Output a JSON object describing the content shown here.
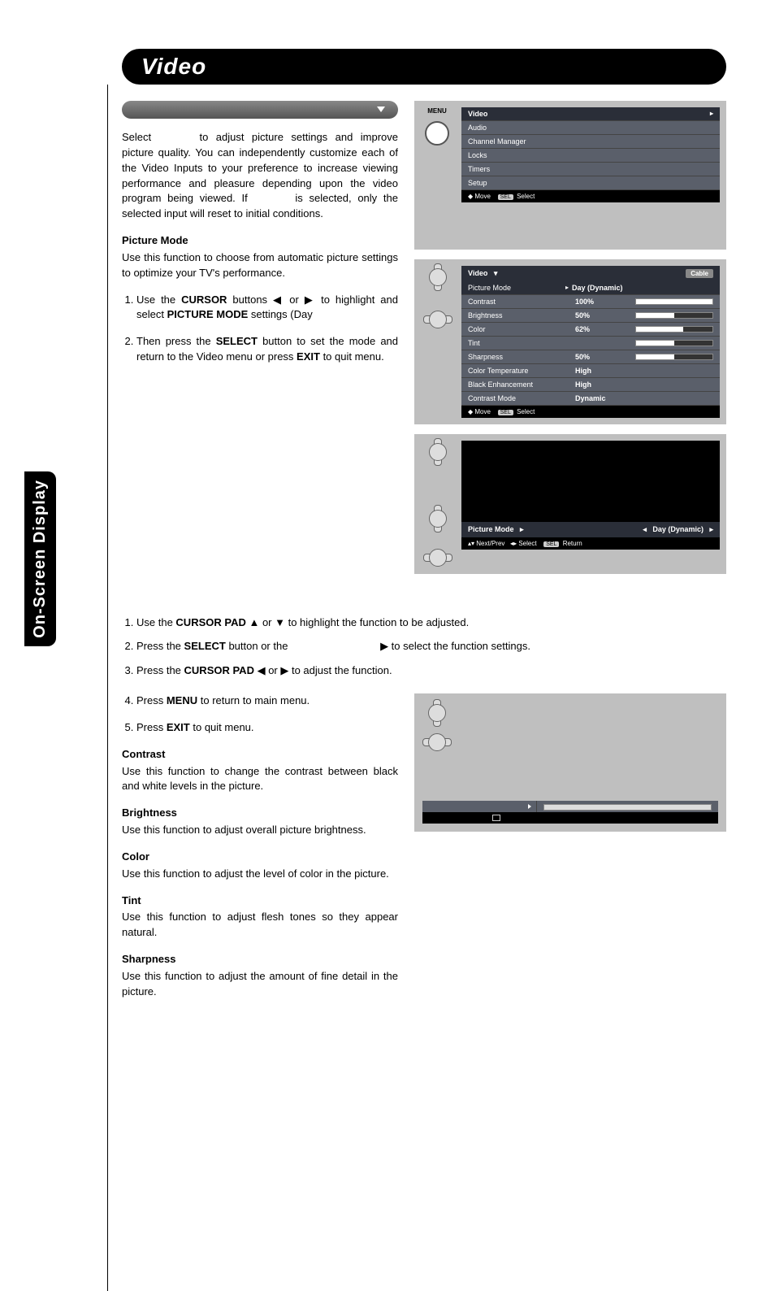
{
  "sideTab": "On-Screen Display",
  "header": "Video",
  "intro": {
    "p1a": "Select ",
    "p1b": " to adjust picture settings and improve picture quality. You can independently customize each of the Video Inputs to your preference to increase viewing performance and pleasure depending upon the video program being viewed. If ",
    "p1c": " is selected, only the selected input will reset to initial conditions."
  },
  "pictureMode": {
    "heading": "Picture Mode",
    "desc": "Use this function to choose from automatic picture settings to optimize your TV's performance.",
    "step1a": "Use the ",
    "step1b": "CURSOR",
    "step1c": " buttons ◀ or ▶ to highlight and select ",
    "step1d": "PICTURE MODE",
    "step1e": " settings (Day",
    "step2a": "Then press the ",
    "step2b": "SELECT",
    "step2c": " button to set the mode and return to the Video menu or press ",
    "step2d": "EXIT",
    "step2e": " to quit menu."
  },
  "osd1": {
    "menuLabel": "MENU",
    "items": [
      "Video",
      "Audio",
      "Channel Manager",
      "Locks",
      "Timers",
      "Setup"
    ],
    "hintMove": "Move",
    "hintSelect": "Select",
    "hintSel": "SEL"
  },
  "osd2": {
    "title": "Video",
    "source": "Cable",
    "rows": [
      {
        "label": "Picture Mode",
        "value": "Day (Dynamic)",
        "bar": null
      },
      {
        "label": "Contrast",
        "value": "100%",
        "bar": 100
      },
      {
        "label": "Brightness",
        "value": "50%",
        "bar": 50
      },
      {
        "label": "Color",
        "value": "62%",
        "bar": 62
      },
      {
        "label": "Tint",
        "value": "",
        "bar": 50
      },
      {
        "label": "Sharpness",
        "value": "50%",
        "bar": 50
      },
      {
        "label": "Color Temperature",
        "value": "High",
        "bar": null
      },
      {
        "label": "Black Enhancement",
        "value": "High",
        "bar": null
      },
      {
        "label": "Contrast Mode",
        "value": "Dynamic",
        "bar": null
      }
    ],
    "hintMove": "Move",
    "hintSel": "SEL",
    "hintSelect": "Select"
  },
  "osd3": {
    "label": "Picture Mode",
    "value": "Day (Dynamic)",
    "hintNext": "Next/Prev",
    "hintSelect": "Select",
    "hintSel": "SEL",
    "hintReturn": "Return"
  },
  "steps": {
    "s1a": "Use the ",
    "s1b": "CURSOR PAD",
    "s1c": " ▲ or ▼ to highlight the function to be adjusted.",
    "s2a": "Press the ",
    "s2b": "SELECT",
    "s2c": " button or the ",
    "s2d": "▶ to select the function settings.",
    "s3a": "Press the ",
    "s3b": "CURSOR PAD",
    "s3c": " ◀ or ▶ to adjust the function.",
    "s4a": "Press ",
    "s4b": "MENU",
    "s4c": " to return to main menu.",
    "s5a": "Press ",
    "s5b": "EXIT",
    "s5c": " to quit menu."
  },
  "sections": {
    "contrast": {
      "h": "Contrast",
      "d": "Use this function to change the contrast between black and white levels in the picture."
    },
    "brightness": {
      "h": "Brightness",
      "d": "Use this function to adjust overall picture brightness."
    },
    "color": {
      "h": "Color",
      "d": "Use this function to adjust the level of color in the picture."
    },
    "tint": {
      "h": "Tint",
      "d": "Use this function to adjust flesh tones so they appear natural."
    },
    "sharpness": {
      "h": "Sharpness",
      "d": "Use this function to adjust the amount of fine detail in the picture."
    }
  }
}
